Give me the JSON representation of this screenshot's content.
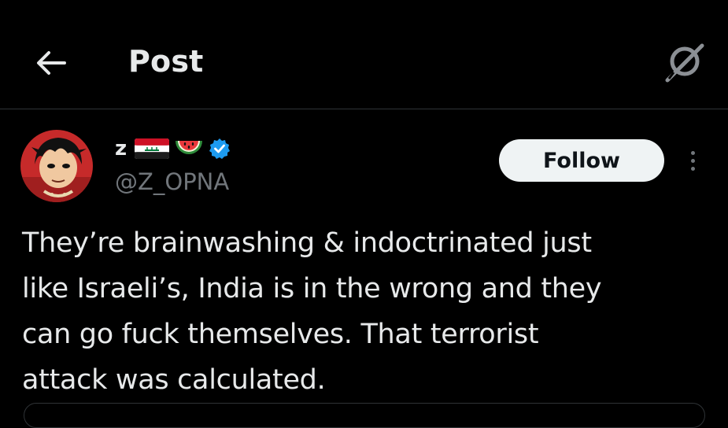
{
  "header": {
    "back_icon": "arrow-left-icon",
    "title": "Post",
    "grok_icon": "grok-icon"
  },
  "post": {
    "author": {
      "display_name": "z",
      "emoji": [
        "iraq-flag-icon",
        "watermelon-icon"
      ],
      "verified": true,
      "verified_color": "#1d9bf0",
      "handle": "@Z_OPNA"
    },
    "follow_label": "Follow",
    "more_icon": "more-vertical-icon",
    "text": "They’re brainwashing & indoctrinated just\nlike Israeli’s, India is in the wrong and they\ncan go fuck themselves. That terrorist\nattack was calculated."
  },
  "colors": {
    "background": "#000000",
    "text_primary": "#e7e9ea",
    "text_secondary": "#71767b",
    "divider": "#2f3336",
    "follow_bg": "#eff3f4",
    "follow_text": "#0f1419"
  }
}
